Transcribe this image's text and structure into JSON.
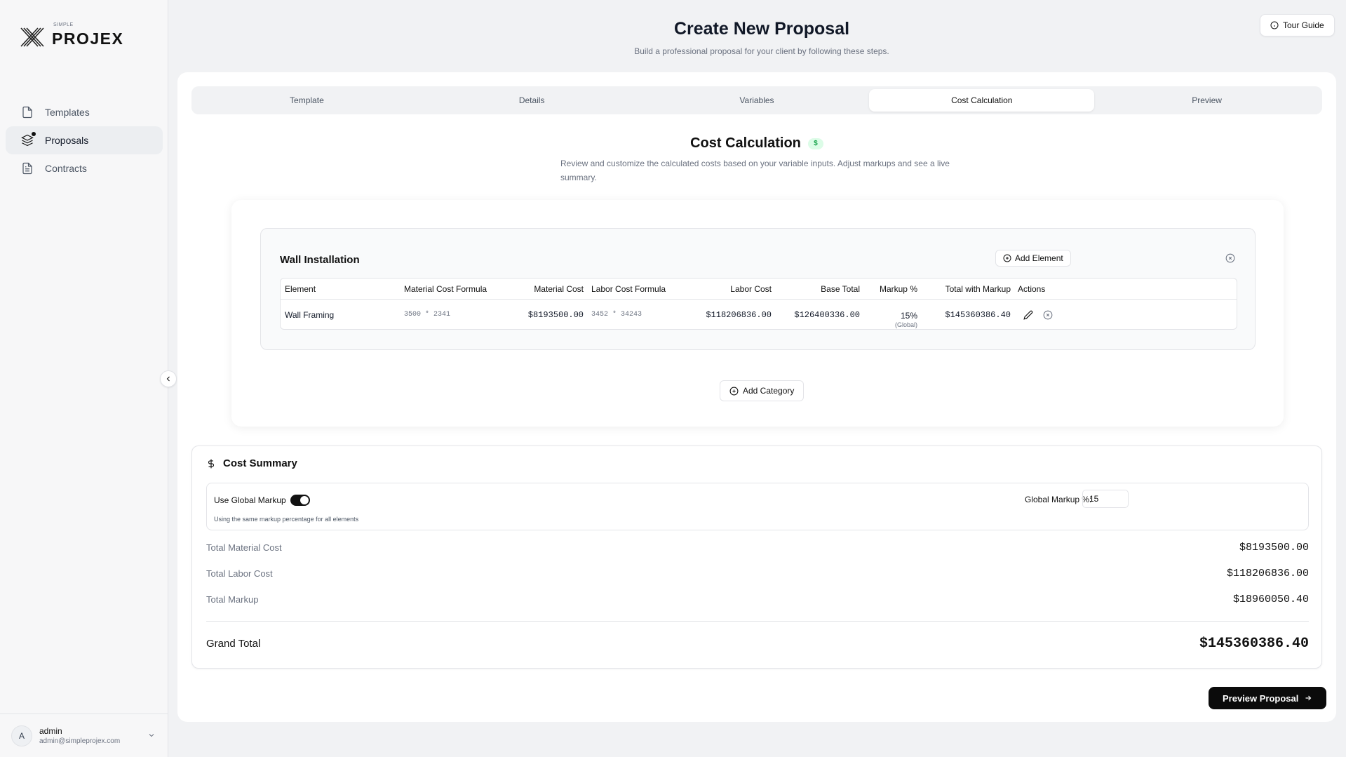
{
  "app": {
    "logo_small": "SIMPLE",
    "logo_name": "PROJEX"
  },
  "sidebar": {
    "items": [
      {
        "label": "Templates",
        "icon": "file-icon",
        "active": false
      },
      {
        "label": "Proposals",
        "icon": "layers-icon",
        "active": true
      },
      {
        "label": "Contracts",
        "icon": "document-icon",
        "active": false
      }
    ],
    "user": {
      "initial": "A",
      "name": "admin",
      "email": "admin@simpleprojex.com"
    }
  },
  "header": {
    "title": "Create New Proposal",
    "subtitle": "Build a professional proposal for your client by following these steps.",
    "tour_label": "Tour Guide"
  },
  "tabs": [
    {
      "label": "Template",
      "active": false
    },
    {
      "label": "Details",
      "active": false
    },
    {
      "label": "Variables",
      "active": false
    },
    {
      "label": "Cost Calculation",
      "active": true
    },
    {
      "label": "Preview",
      "active": false
    }
  ],
  "section": {
    "title": "Cost Calculation",
    "badge": "$",
    "description": "Review and customize the calculated costs based on your variable inputs. Adjust markups and see a live summary."
  },
  "category": {
    "name": "Wall Installation",
    "add_element_label": "Add Element",
    "columns": [
      "Element",
      "Material Cost Formula",
      "Material Cost",
      "Labor Cost Formula",
      "Labor Cost",
      "Base Total",
      "Markup %",
      "Total with Markup",
      "Actions"
    ],
    "rows": [
      {
        "element": "Wall Framing",
        "material_formula": "3500 * 2341",
        "material_cost": "$8193500.00",
        "labor_formula": "3452 * 34243",
        "labor_cost": "$118206836.00",
        "base_total": "$126400336.00",
        "markup": "15%",
        "markup_note": "(Global)",
        "total_with_markup": "$145360386.40"
      }
    ]
  },
  "add_category_label": "Add Category",
  "summary": {
    "title": "Cost Summary",
    "global_markup_label": "Use Global Markup",
    "global_markup_enabled": true,
    "global_markup_help": "Using the same markup percentage for all elements",
    "global_markup_input_label": "Global Markup %:",
    "global_markup_value": "15",
    "lines": [
      {
        "label": "Total Material Cost",
        "value": "$8193500.00"
      },
      {
        "label": "Total Labor Cost",
        "value": "$118206836.00"
      },
      {
        "label": "Total Markup",
        "value": "$18960050.40"
      }
    ],
    "grand_label": "Grand Total",
    "grand_value": "$145360386.40"
  },
  "preview_label": "Preview Proposal",
  "colors": {
    "primary": "#0b0b0b",
    "badge_bg": "#dcfce7",
    "badge_fg": "#16a34a",
    "background": "#f1f2f4"
  }
}
